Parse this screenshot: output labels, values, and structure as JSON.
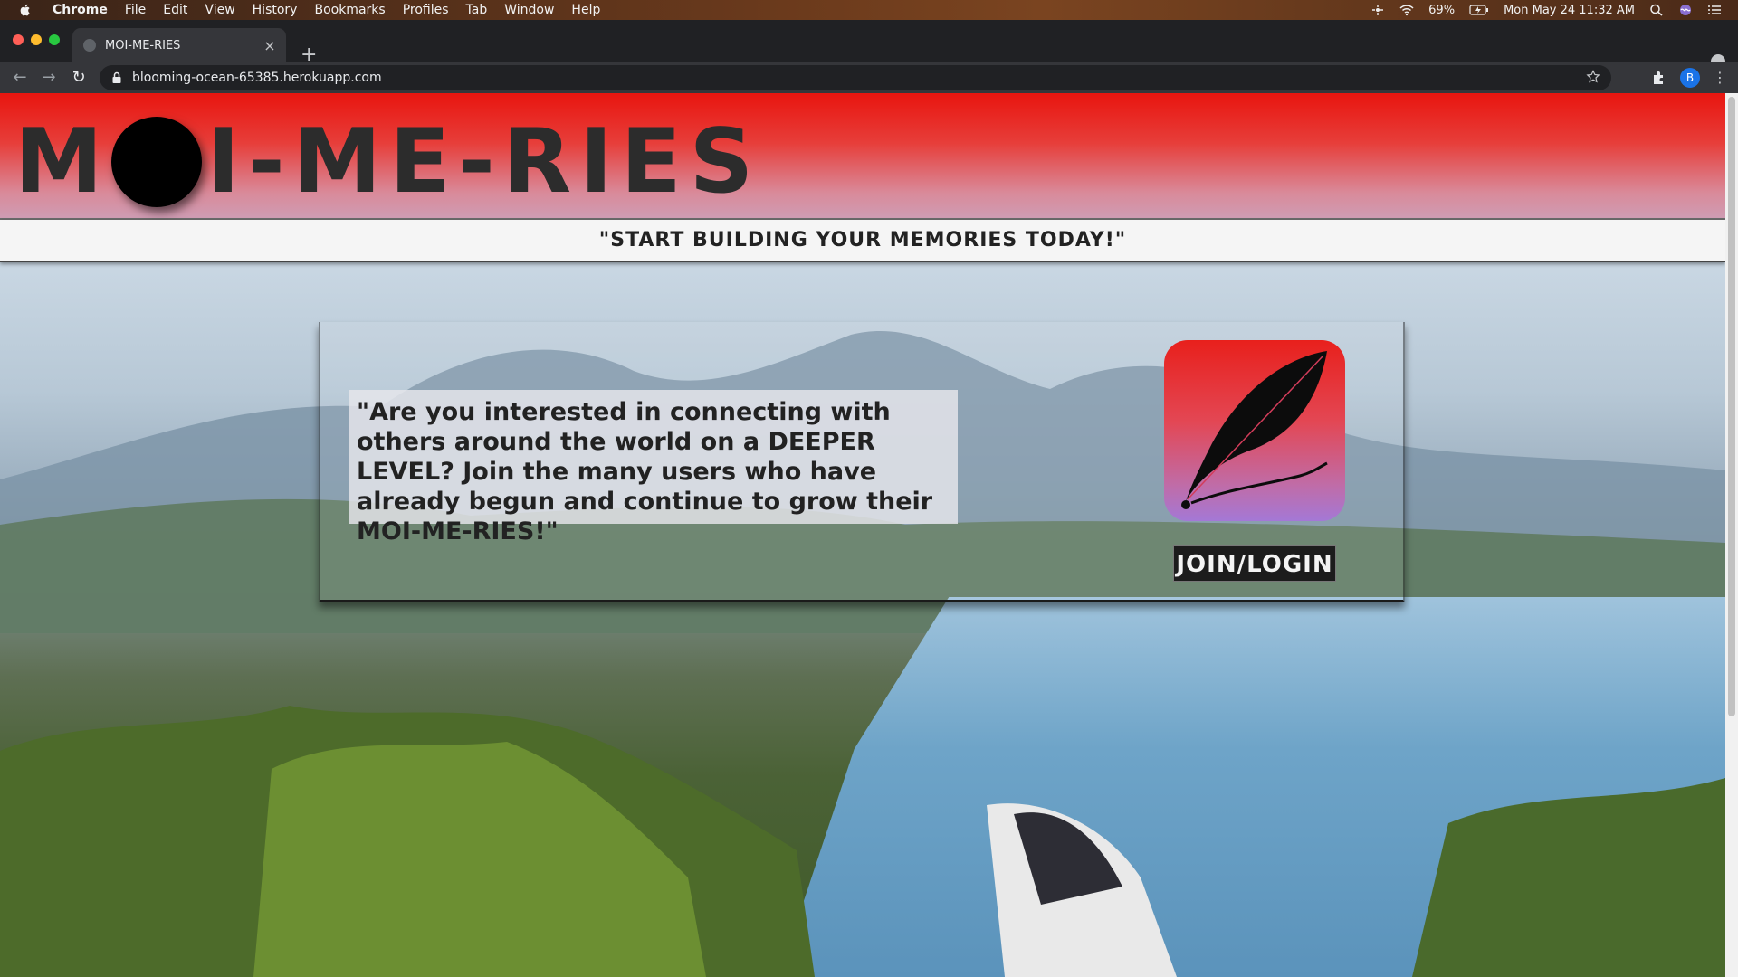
{
  "os_menubar": {
    "app_name": "Chrome",
    "menus": [
      "File",
      "Edit",
      "View",
      "History",
      "Bookmarks",
      "Profiles",
      "Tab",
      "Window",
      "Help"
    ],
    "battery": "69%",
    "datetime": "Mon May 24  11:32 AM"
  },
  "browser": {
    "tab_title": "MOI-ME-RIES",
    "tab_close": "×",
    "new_tab": "+",
    "url": "blooming-ocean-65385.herokuapp.com",
    "profile_initial": "B",
    "back": "←",
    "forward": "→",
    "reload": "↻",
    "menu": "⋮"
  },
  "page": {
    "logo_before": "M",
    "logo_after": "I-ME-RIES",
    "tagline": "\"START BUILDING YOUR MEMORIES TODAY!\"",
    "intro": "\"Are you interested in connecting with others around the world on a DEEPER LEVEL? Join the many users who have already begun and continue to grow their MOI-ME-RIES!\"",
    "join_label": "JOIN/LOGIN"
  },
  "colors": {
    "header_red": "#e8150f",
    "header_pink": "#cf9cb3",
    "button_dark": "#1c1c1c"
  }
}
